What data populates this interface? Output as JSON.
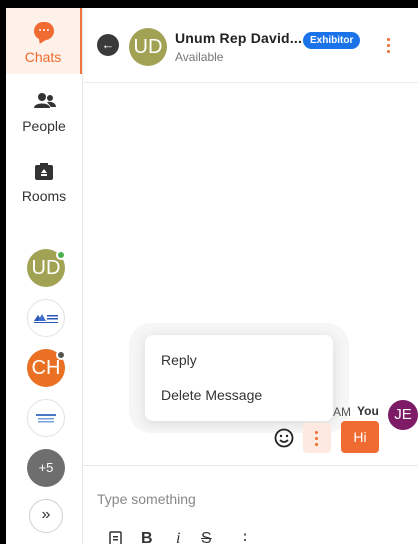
{
  "sidebar": {
    "nav": [
      {
        "label": "Chats",
        "icon": "chat-bubble-icon"
      },
      {
        "label": "People",
        "icon": "people-icon"
      },
      {
        "label": "Rooms",
        "icon": "rooms-icon"
      }
    ],
    "conversations": [
      {
        "initials": "UD",
        "color": "#a2a254",
        "status_color": "#4caf50"
      },
      {
        "type": "logo",
        "icon": "organization-logo-icon"
      },
      {
        "initials": "CH",
        "color": "#ea7024",
        "status_color": "#555555"
      },
      {
        "type": "logo",
        "icon": "organization-logo-icon"
      }
    ],
    "more_count": "+5",
    "expand_label": "»"
  },
  "header": {
    "avatar_initials": "UD",
    "name": "Unum Rep David...",
    "badge": "Exhibitor",
    "status": "Available"
  },
  "messages": {
    "time_partial": "AM",
    "sender": "You",
    "sender_initials": "JE",
    "text": "Hi"
  },
  "context_menu": {
    "items": [
      "Reply",
      "Delete Message"
    ]
  },
  "composer": {
    "placeholder": "Type something",
    "toolbar": {
      "bold": "B",
      "italic": "i",
      "strike": "S"
    }
  },
  "colors": {
    "accent": "#ef6b2e",
    "badge": "#1a73e8"
  }
}
